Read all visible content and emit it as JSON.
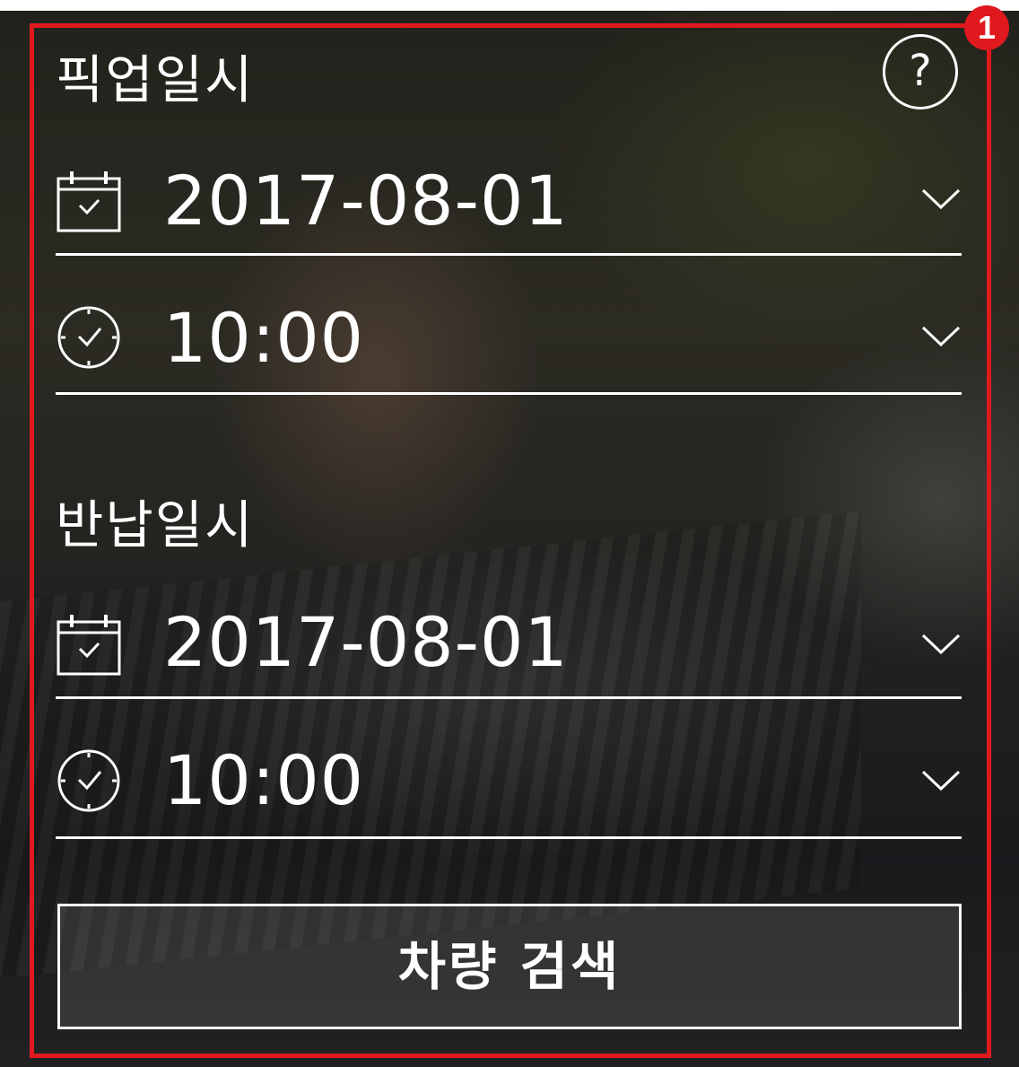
{
  "pickup": {
    "title": "픽업일시",
    "date_value": "2017-08-01",
    "time_value": "10:00"
  },
  "return": {
    "title": "반납일시",
    "date_value": "2017-08-01",
    "time_value": "10:00"
  },
  "help": {
    "label": "?"
  },
  "search": {
    "label": "차량 검색"
  },
  "annotation": {
    "badge": "1",
    "color": "#e0191f"
  },
  "icons": {
    "date": "calendar-check-icon",
    "time": "clock-icon",
    "dropdown": "chevron-down-icon"
  }
}
